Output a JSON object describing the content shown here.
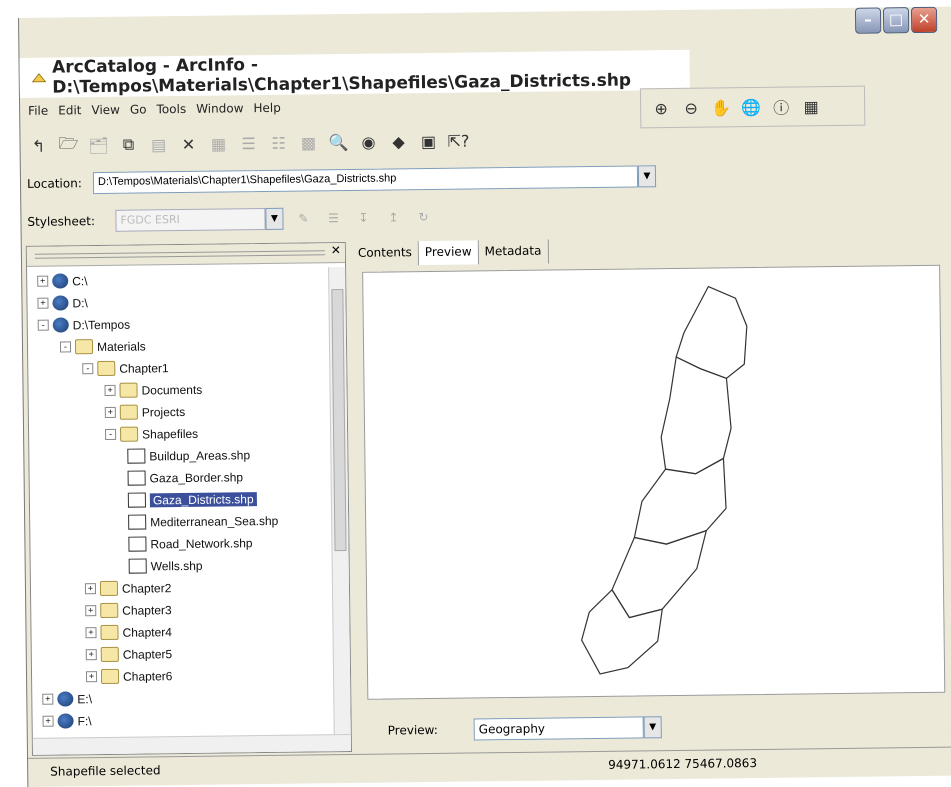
{
  "window": {
    "title": "ArcCatalog - ArcInfo - D:\\Tempos\\Materials\\Chapter1\\Shapefiles\\Gaza_Districts.shp"
  },
  "menu": [
    "File",
    "Edit",
    "View",
    "Go",
    "Tools",
    "Window",
    "Help"
  ],
  "location": {
    "label": "Location:",
    "value": "D:\\Tempos\\Materials\\Chapter1\\Shapefiles\\Gaza_Districts.shp"
  },
  "stylesheet": {
    "label": "Stylesheet:",
    "value": "FGDC ESRI"
  },
  "tabs": [
    "Contents",
    "Preview",
    "Metadata"
  ],
  "tree": [
    {
      "label": "C:\\",
      "icon": "drive",
      "expander": "+"
    },
    {
      "label": "D:\\",
      "icon": "drive",
      "expander": "+"
    },
    {
      "label": "D:\\Tempos",
      "icon": "drive",
      "expander": "-"
    },
    {
      "label": "Materials",
      "icon": "folder",
      "expander": "-"
    },
    {
      "label": "Chapter1",
      "icon": "folder",
      "expander": "-"
    },
    {
      "label": "Documents",
      "icon": "folder",
      "expander": "+"
    },
    {
      "label": "Projects",
      "icon": "folder",
      "expander": "+"
    },
    {
      "label": "Shapefiles",
      "icon": "folder",
      "expander": "-"
    },
    {
      "label": "Buildup_Areas.shp",
      "icon": "shapefile",
      "expander": ""
    },
    {
      "label": "Gaza_Border.shp",
      "icon": "shapefile",
      "expander": ""
    },
    {
      "label": "Gaza_Districts.shp",
      "icon": "shapefile",
      "expander": "",
      "selected": true
    },
    {
      "label": "Mediterranean_Sea.shp",
      "icon": "shapefile",
      "expander": ""
    },
    {
      "label": "Road_Network.shp",
      "icon": "shapefile",
      "expander": ""
    },
    {
      "label": "Wells.shp",
      "icon": "shapefile",
      "expander": ""
    },
    {
      "label": "Chapter2",
      "icon": "folder",
      "expander": "+"
    },
    {
      "label": "Chapter3",
      "icon": "folder",
      "expander": "+"
    },
    {
      "label": "Chapter4",
      "icon": "folder",
      "expander": "+"
    },
    {
      "label": "Chapter5",
      "icon": "folder",
      "expander": "+"
    },
    {
      "label": "Chapter6",
      "icon": "folder",
      "expander": "+"
    },
    {
      "label": "E:\\",
      "icon": "drive",
      "expander": "+"
    },
    {
      "label": "F:\\",
      "icon": "drive",
      "expander": "+"
    }
  ],
  "preview": {
    "label": "Preview:",
    "value": "Geography"
  },
  "status": {
    "text": "Shapefile selected",
    "coordinates": "94971.0612  75467.0863"
  }
}
